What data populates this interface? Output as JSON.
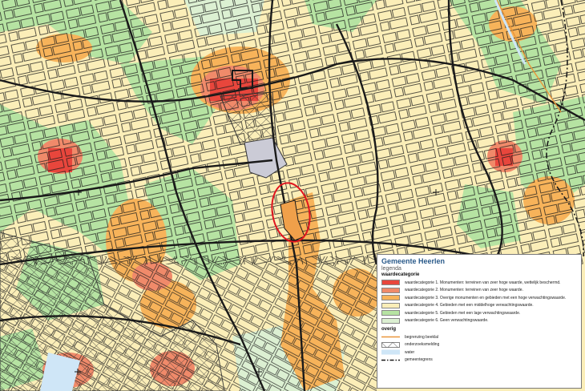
{
  "legend": {
    "title": "Gemeente Heerlen",
    "subtitle": "legenda",
    "section1": "waardecategorie",
    "categories": [
      {
        "label": "waardecategorie 1. Monumenten: terreinen van zeer hoge waarde, wettelijk beschermd.",
        "color": "#e8463c"
      },
      {
        "label": "waardecategorie 2. Monumenten: terreinen van zeer hoge waarde.",
        "color": "#f08a6a"
      },
      {
        "label": "waardecategorie 3. Overige monumenten en gebieden met een hoge verwachtingswaarde.",
        "color": "#f7b35a"
      },
      {
        "label": "waardecategorie 4. Gebieden met een middelhoge verwachtingswaarde.",
        "color": "#fbeeb8"
      },
      {
        "label": "waardecategorie 5. Gebieden met een lage verwachtingswaarde.",
        "color": "#b6e3a2"
      },
      {
        "label": "waardecategorie 6. Geen verwachtingswaarde.",
        "color": "#dcf0d2"
      }
    ],
    "section2": "overig",
    "other": [
      {
        "label": "begrenzing beeklal",
        "icon": "orange-line-icon"
      },
      {
        "label": "onderzoeksmelding",
        "icon": "hatched-area-icon"
      },
      {
        "label": "water",
        "icon": "water-icon"
      },
      {
        "label": "gemeentegrens",
        "icon": "dashed-boundary-icon"
      }
    ]
  },
  "colors": {
    "highlight_ellipse": "#e0141e",
    "street_line": "#1a1a1a",
    "water": "#cfe6f7"
  }
}
